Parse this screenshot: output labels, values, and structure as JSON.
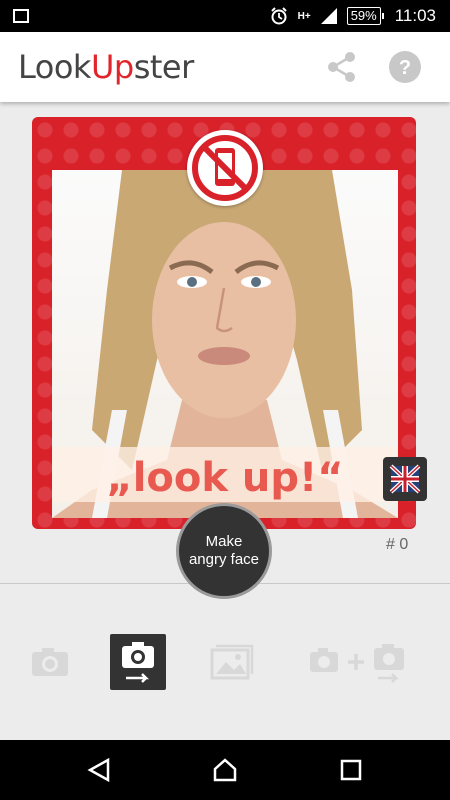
{
  "status_bar": {
    "network": "H+",
    "battery": "59%",
    "time": "11:03"
  },
  "app_bar": {
    "logo_part1": "Look",
    "logo_part2": "Up",
    "logo_part3": "ster",
    "share_icon": "share-icon",
    "help_icon": "help-icon"
  },
  "card": {
    "slogan": "„look up!“",
    "badge_icon": "no-phone-icon",
    "language_icon": "uk-flag-icon"
  },
  "counter": "# 0",
  "action_button": {
    "label": "Make angry face"
  },
  "modes": [
    {
      "name": "camera-icon"
    },
    {
      "name": "camera-switch-icon"
    },
    {
      "name": "gallery-icon"
    },
    {
      "name": "camera-plus-camera-icon"
    }
  ],
  "nav": [
    "back-icon",
    "home-icon",
    "recents-icon"
  ]
}
